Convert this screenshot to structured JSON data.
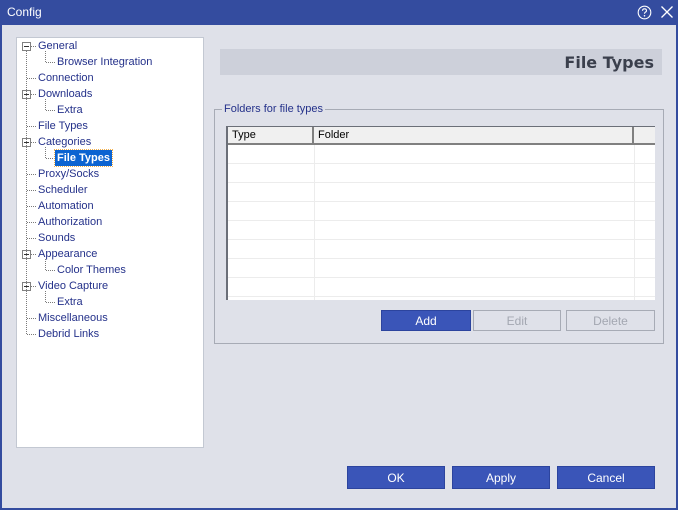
{
  "window": {
    "title": "Config",
    "help_icon": "help-circle-icon",
    "close_icon": "close-icon"
  },
  "tree": {
    "items": [
      {
        "label": "General",
        "level": 0,
        "expanded": true
      },
      {
        "label": "Browser Integration",
        "level": 1
      },
      {
        "label": "Connection",
        "level": 0
      },
      {
        "label": "Downloads",
        "level": 0,
        "expanded": true
      },
      {
        "label": "Extra",
        "level": 1
      },
      {
        "label": "File Types",
        "level": 0
      },
      {
        "label": "Categories",
        "level": 0,
        "expanded": true
      },
      {
        "label": "File Types",
        "level": 1,
        "selected": true
      },
      {
        "label": "Proxy/Socks",
        "level": 0
      },
      {
        "label": "Scheduler",
        "level": 0
      },
      {
        "label": "Automation",
        "level": 0
      },
      {
        "label": "Authorization",
        "level": 0
      },
      {
        "label": "Sounds",
        "level": 0
      },
      {
        "label": "Appearance",
        "level": 0,
        "expanded": true
      },
      {
        "label": "Color Themes",
        "level": 1
      },
      {
        "label": "Video Capture",
        "level": 0,
        "expanded": true
      },
      {
        "label": "Extra",
        "level": 1
      },
      {
        "label": "Miscellaneous",
        "level": 0
      },
      {
        "label": "Debrid Links",
        "level": 0
      }
    ]
  },
  "page": {
    "title": "File Types",
    "group_label": "Folders for file types",
    "table": {
      "columns": [
        "Type",
        "Folder"
      ],
      "rows": []
    },
    "buttons": {
      "add": "Add",
      "edit": "Edit",
      "delete": "Delete"
    }
  },
  "footer": {
    "ok": "OK",
    "apply": "Apply",
    "cancel": "Cancel"
  },
  "colors": {
    "titlebar": "#344c9f",
    "accent_button": "#3a55b8",
    "selection": "#0b63d1",
    "background": "#dfe1e9"
  }
}
